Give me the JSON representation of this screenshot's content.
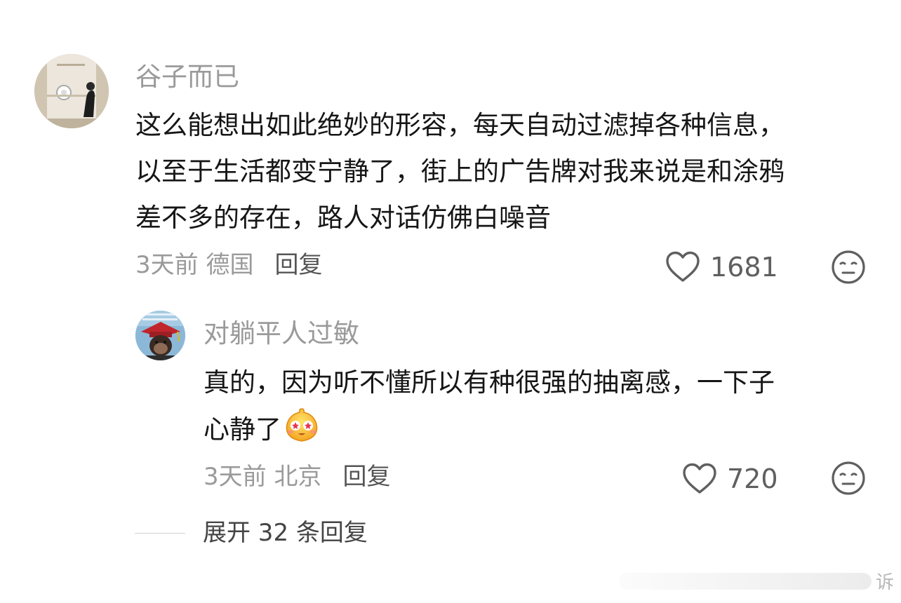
{
  "comment": {
    "username": "谷子而已",
    "lines": [
      "这么能想出如此绝妙的形容，每天自动过滤掉各种信息，",
      "以至于生活都变宁静了，街上的广告牌对我来说是和涂鸦",
      "差不多的存在，路人对话仿佛白噪音"
    ],
    "meta_time": "3天前 德国",
    "reply_label": "回复",
    "likes": "1681"
  },
  "reply": {
    "username": "对躺平人过敏",
    "lines": [
      "真的，因为听不懂所以有种很强的抽离感，一下子",
      "心静了"
    ],
    "meta_time": "3天前 北京",
    "reply_label": "回复",
    "likes": "720"
  },
  "expand_label": "展开 32 条回复",
  "watermark_text": "诉",
  "icons": {
    "like": "heart-outline-icon",
    "dislike": "neutral-face-icon",
    "emoji": "starry-eyed-emoji"
  },
  "colors": {
    "text_primary": "#161616",
    "text_secondary": "#9a9a9a",
    "icon": "#5f5f5f"
  }
}
